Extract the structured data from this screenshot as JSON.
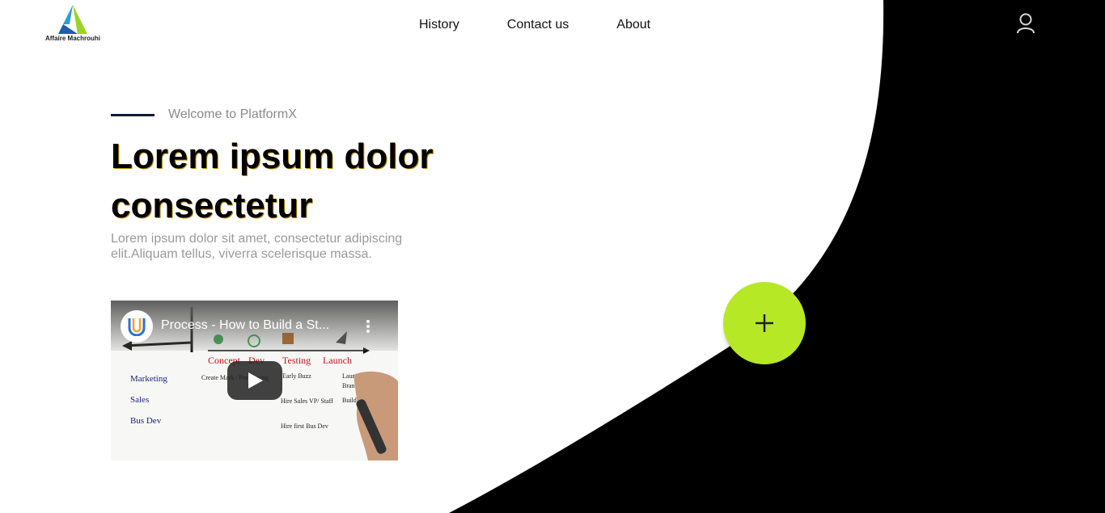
{
  "brand": {
    "name": "Affaire Machrouhi"
  },
  "nav": {
    "items": [
      "History",
      "Contact us",
      "About"
    ]
  },
  "hero": {
    "welcome": "Welcome to PlatformX",
    "title": "Lorem ipsum dolor consectetur",
    "description": "Lorem ipsum dolor sit amet, consectetur adipiscing elit.Aliquam tellus, viverra scelerisque massa."
  },
  "video": {
    "title": "Process - How to Build a St...",
    "sketch_labels": {
      "stages": [
        "Concept",
        "Dev",
        "Testing",
        "Launch"
      ],
      "rows": [
        "Marketing",
        "Sales",
        "Bus Dev"
      ],
      "notes": [
        "Create Mark / Positioning",
        "Early Buzz",
        "Hire Sales VP/ Staff",
        "Hire first Bus Dev",
        "Launch Event",
        "Branding",
        "Build Organization"
      ]
    }
  },
  "icons": {
    "user": "user-icon",
    "fab": "plus-icon",
    "play": "play-icon",
    "menu": "more-vert-icon"
  },
  "colors": {
    "accent": "#b7e825",
    "dark": "#000000",
    "line": "#0c1a3c"
  }
}
